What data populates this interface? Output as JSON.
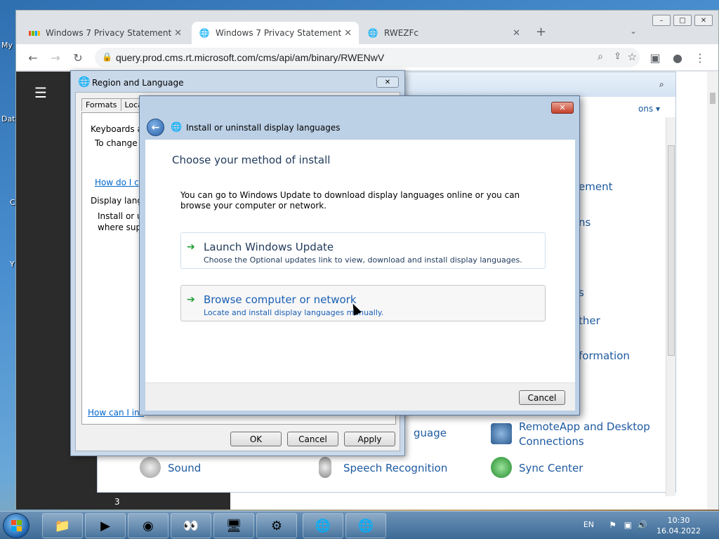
{
  "desktop": {
    "icon_labels": [
      "My",
      "Dat",
      "C",
      "Y"
    ]
  },
  "browser": {
    "tabs": [
      {
        "title": "Windows 7 Privacy Statement",
        "active": false
      },
      {
        "title": "Windows 7 Privacy Statement",
        "active": true
      },
      {
        "title": "RWEZFc",
        "active": false
      }
    ],
    "new_tab": "+",
    "url": "query.prod.cms.rt.microsoft.com/cms/api/am/binary/RWENwV",
    "page_number": "3",
    "window_controls": [
      "–",
      "□",
      "✕"
    ]
  },
  "control_panel": {
    "options_link": "ons ▾",
    "items_partial": [
      "ement",
      "ns",
      "s",
      "ther",
      "formation"
    ],
    "items": [
      {
        "label": "Sound",
        "icon": "speaker-icon"
      },
      {
        "label": "Speech Recognition",
        "icon": "microphone-icon"
      },
      {
        "label": "Sync Center",
        "icon": "sync-icon"
      },
      {
        "label": "RemoteApp and Desktop Connections",
        "icon": "remote-desktop-icon"
      },
      {
        "label": "guage",
        "icon": ""
      }
    ]
  },
  "region_dialog": {
    "title": "Region and Language",
    "tabs": [
      "Formats",
      "Locat"
    ],
    "group1_title": "Keyboards a",
    "group1_text": "To change",
    "group1_link": "How do I c",
    "group2_title": "Display lang",
    "group2_text1": "Install or u",
    "group2_text2": "where sup",
    "footer_link": "How can I ins",
    "buttons": {
      "ok": "OK",
      "cancel": "Cancel",
      "apply": "Apply"
    }
  },
  "install_dialog": {
    "window_title": "Install or uninstall display languages",
    "heading": "Choose your method of install",
    "description": "You can go to Windows Update to download display languages online or you can browse your computer or network.",
    "options": [
      {
        "title": "Launch Windows Update",
        "subtitle": "Choose the Optional updates link to view, download and install display languages."
      },
      {
        "title": "Browse computer or network",
        "subtitle": "Locate and install display languages manually."
      }
    ],
    "cancel_label": "Cancel"
  },
  "taskbar": {
    "language": "EN",
    "time": "10:30",
    "date": "16.04.2022"
  }
}
